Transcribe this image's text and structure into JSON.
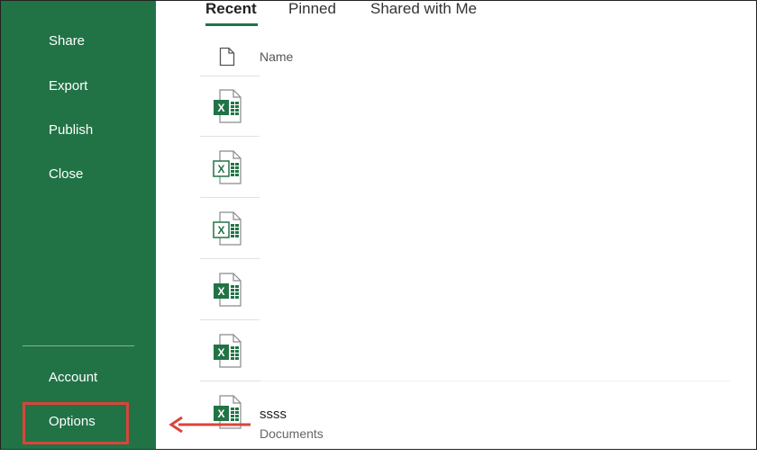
{
  "sidebar": {
    "items": [
      {
        "label": "Share"
      },
      {
        "label": "Export"
      },
      {
        "label": "Publish"
      },
      {
        "label": "Close"
      }
    ],
    "bottom_items": [
      {
        "label": "Account"
      },
      {
        "label": "Options"
      }
    ],
    "background_color": "#217346"
  },
  "tabs": [
    {
      "label": "Recent",
      "active": true
    },
    {
      "label": "Pinned",
      "active": false
    },
    {
      "label": "Shared with Me",
      "active": false
    }
  ],
  "list": {
    "column_header": "Name",
    "files": [
      {
        "name": "",
        "location": "",
        "icon": "excel-file-icon"
      },
      {
        "name": "",
        "location": "",
        "icon": "excel-file-icon"
      },
      {
        "name": "",
        "location": "",
        "icon": "excel-file-icon"
      },
      {
        "name": "",
        "location": "",
        "icon": "excel-file-icon"
      },
      {
        "name": "",
        "location": "",
        "icon": "excel-file-icon"
      },
      {
        "name": "ssss",
        "location": "Documents",
        "icon": "excel-file-icon"
      }
    ]
  },
  "annotation": {
    "highlight_color": "#d9453a",
    "arrow_color": "#d9453a"
  }
}
